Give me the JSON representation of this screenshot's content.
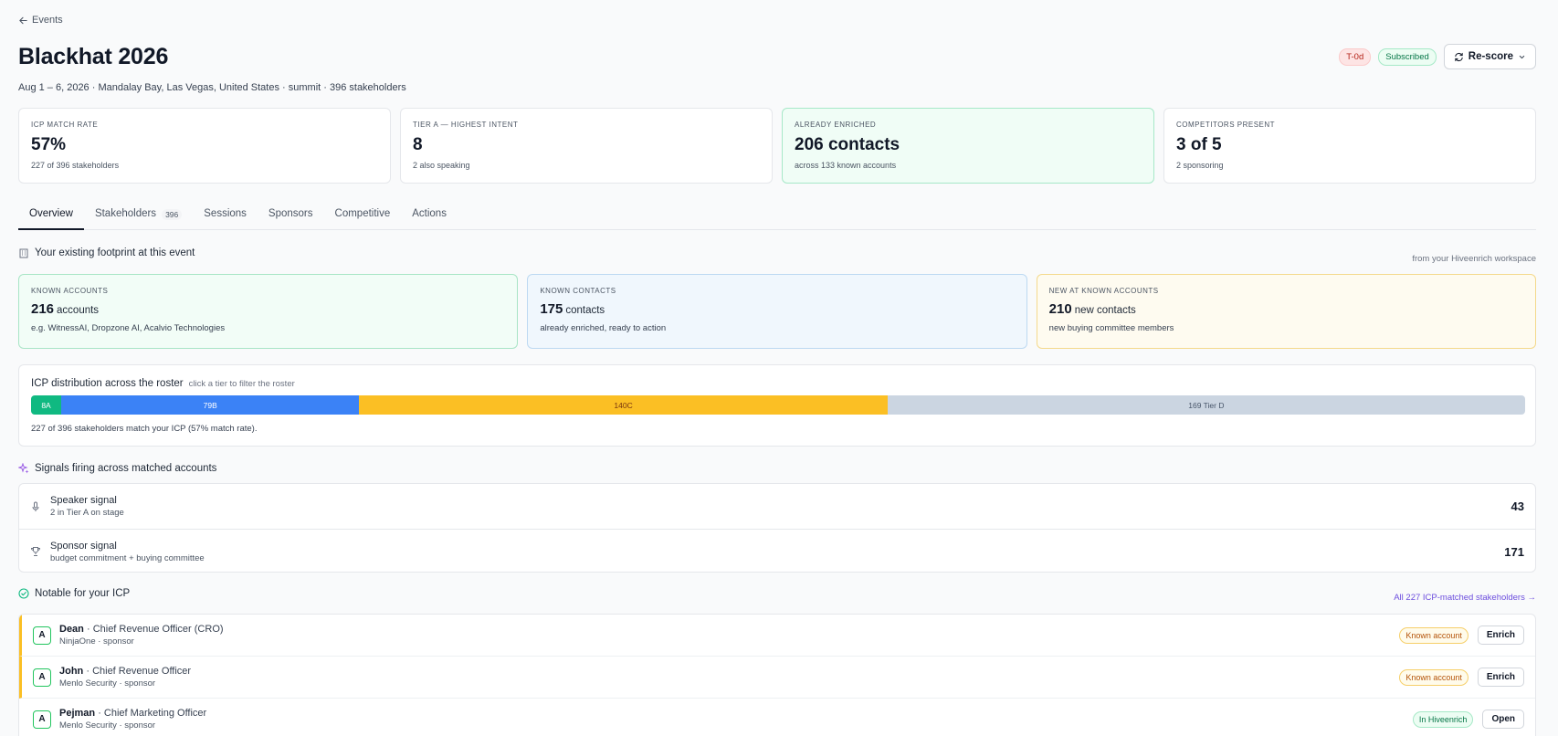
{
  "nav": {
    "back_label": "Events"
  },
  "event": {
    "title": "Blackhat 2026",
    "subtitle": "Aug 1 – 6, 2026 · Mandalay Bay, Las Vegas, United States · summit · 396 stakeholders",
    "badges": {
      "timing": "T-0d",
      "status": "Subscribed"
    },
    "rescore_label": "Re-score"
  },
  "stats": [
    {
      "label": "ICP MATCH RATE",
      "value": "57%",
      "sub": "227 of 396 stakeholders"
    },
    {
      "label": "TIER A — HIGHEST INTENT",
      "value": "8",
      "sub": "2 also speaking"
    },
    {
      "label": "ALREADY ENRICHED",
      "value": "206 contacts",
      "sub": "across 133 known accounts"
    },
    {
      "label": "COMPETITORS PRESENT",
      "value": "3 of 5",
      "sub": "2 sponsoring"
    }
  ],
  "tabs": [
    {
      "label": "Overview"
    },
    {
      "label": "Stakeholders",
      "count": "396"
    },
    {
      "label": "Sessions"
    },
    {
      "label": "Sponsors"
    },
    {
      "label": "Competitive"
    },
    {
      "label": "Actions"
    }
  ],
  "footprint": {
    "title": "Your existing footprint at this event",
    "source": "from your Hiveenrich workspace",
    "cards": [
      {
        "label": "KNOWN ACCOUNTS",
        "value": "216",
        "unit": "accounts",
        "sub": "e.g. WitnessAI, Dropzone AI, Acalvio Technologies"
      },
      {
        "label": "KNOWN CONTACTS",
        "value": "175",
        "unit": "contacts",
        "sub": "already enriched, ready to action"
      },
      {
        "label": "NEW AT KNOWN ACCOUNTS",
        "value": "210",
        "unit": "new contacts",
        "sub": "new buying committee members"
      }
    ]
  },
  "distribution": {
    "title": "ICP distribution across the roster",
    "hint": "click a tier to filter the roster",
    "segments": [
      {
        "label": "8A",
        "value": 8,
        "color": "#10b981",
        "text_color": "#ffffff"
      },
      {
        "label": "79B",
        "value": 79,
        "color": "#3b82f6",
        "text_color": "#ffffff"
      },
      {
        "label": "140C",
        "value": 140,
        "color": "#fbbf24",
        "text_color": "#78350f"
      },
      {
        "label": "169 Tier D",
        "value": 169,
        "color": "#cbd5e1",
        "text_color": "#475569"
      }
    ],
    "footnote": "227 of 396 stakeholders match your ICP (57% match rate)."
  },
  "signals": {
    "title": "Signals firing across matched accounts",
    "items": [
      {
        "name": "Speaker signal",
        "sub": "2 in Tier A on stage",
        "count": "43",
        "icon": "microphone-icon"
      },
      {
        "name": "Sponsor signal",
        "sub": "budget commitment + buying committee",
        "count": "171",
        "icon": "trophy-icon"
      }
    ]
  },
  "notable": {
    "title": "Notable for your ICP",
    "link": "All 227 ICP-matched stakeholders →",
    "people": [
      {
        "tier": "A",
        "name": "Dean",
        "role": "Chief Revenue Officer (CRO)",
        "company": "NinjaOne · sponsor",
        "tag": "Known account",
        "action": "Enrich"
      },
      {
        "tier": "A",
        "name": "John",
        "role": "Chief Revenue Officer",
        "company": "Menlo Security · sponsor",
        "tag": "Known account",
        "action": "Enrich"
      },
      {
        "tier": "A",
        "name": "Pejman",
        "role": "Chief Marketing Officer",
        "company": "Menlo Security · sponsor",
        "tag": "In Hiveenrich",
        "action": "Open"
      }
    ]
  }
}
